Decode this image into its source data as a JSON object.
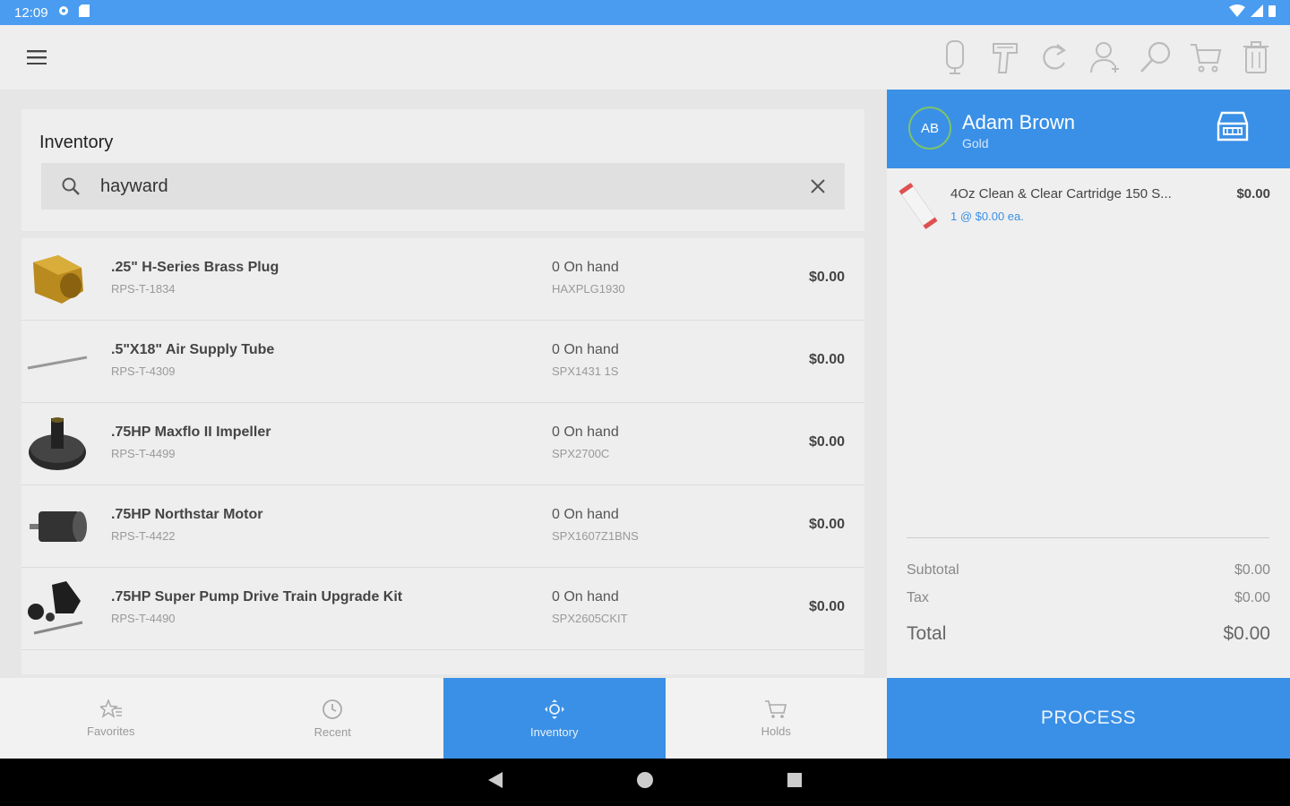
{
  "status_bar": {
    "time": "12:09"
  },
  "inventory": {
    "title": "Inventory",
    "search_value": "hayward",
    "items": [
      {
        "name": ".25\" H-Series Brass Plug",
        "sku": "RPS-T-1834",
        "stock": "0 On hand",
        "code": "HAXPLG1930",
        "price": "$0.00"
      },
      {
        "name": ".5\"X18\" Air Supply Tube",
        "sku": "RPS-T-4309",
        "stock": "0 On hand",
        "code": "SPX1431 1S",
        "price": "$0.00"
      },
      {
        "name": ".75HP Maxflo II Impeller",
        "sku": "RPS-T-4499",
        "stock": "0 On hand",
        "code": "SPX2700C",
        "price": "$0.00"
      },
      {
        "name": ".75HP Northstar Motor",
        "sku": "RPS-T-4422",
        "stock": "0 On hand",
        "code": "SPX1607Z1BNS",
        "price": "$0.00"
      },
      {
        "name": ".75HP Super Pump Drive Train Upgrade Kit",
        "sku": "RPS-T-4490",
        "stock": "0 On hand",
        "code": "SPX2605CKIT",
        "price": "$0.00"
      }
    ]
  },
  "bottom_nav": {
    "favorites": "Favorites",
    "recent": "Recent",
    "inventory": "Inventory",
    "holds": "Holds"
  },
  "customer": {
    "initials": "AB",
    "name": "Adam Brown",
    "tier": "Gold"
  },
  "cart": {
    "items": [
      {
        "name": "4Oz Clean & Clear Cartridge 150 S...",
        "qty": "1 @ $0.00 ea.",
        "price": "$0.00"
      }
    ],
    "subtotal_label": "Subtotal",
    "subtotal": "$0.00",
    "tax_label": "Tax",
    "tax": "$0.00",
    "total_label": "Total",
    "total": "$0.00"
  },
  "process_label": "PROCESS",
  "colors": {
    "accent": "#3a90e6",
    "status_bar": "#4a9cf0",
    "avatar_ring": "#7cc36b"
  },
  "icons": [
    "menu-icon",
    "microphone-icon",
    "barcode-scanner-icon",
    "refresh-icon",
    "add-customer-icon",
    "search-icon",
    "cart-icon",
    "trash-icon",
    "favorites-icon",
    "clock-icon",
    "inventory-icon",
    "holds-cart-icon",
    "car-icon",
    "back-icon",
    "home-icon",
    "recents-icon"
  ]
}
